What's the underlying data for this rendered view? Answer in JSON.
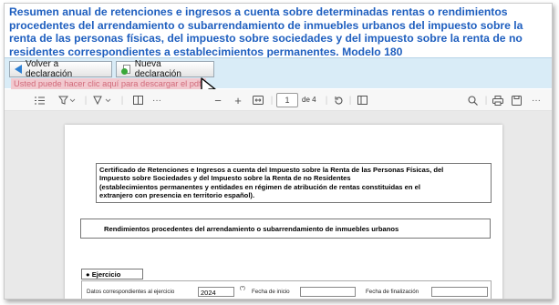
{
  "title": "Resumen anual de retenciones e ingresos a cuenta sobre determinadas rentas o rendimientos procedentes del arrendamiento o subarrendamiento de inmuebles urbanos del impuesto sobre la renta de las personas físicas, del impuesto sobre sociedades y del impuesto sobre la renta de no residentes correspondientes a establecimientos permanentes. Modelo 180",
  "buttons": {
    "back_label": "Volver a declaración",
    "new_label": "Nueva declaración"
  },
  "download_link": "Usted puede hacer clic aquí para descargar el pdf.",
  "pdf_toolbar": {
    "current_page": "1",
    "page_total": "de 4",
    "zoom_out": "−",
    "zoom_in": "+",
    "more": "···"
  },
  "document": {
    "certificate_lines": [
      "Certificado de Retenciones e Ingresos a cuenta del Impuesto sobre la Renta de las Personas Físicas, del",
      "Impuesto sobre Sociedades y del Impuesto sobre la Renta de no Residentes",
      "(establecimientos  permanentes y entidades en  régimen de atribución de  rentas constituidas en el",
      "extranjero con presencia en territorio español)."
    ],
    "section_heading": "Rendimientos procedentes del arrendamiento o subarrendamiento de inmuebles urbanos",
    "ejercicio_label": "● Ejercicio",
    "datos_label": "Datos correspondientes al ejercicio",
    "year_value": "2024",
    "note_mark": "(*)",
    "start_date_label": "Fecha de inicio",
    "end_date_label": "Fecha de finalización"
  },
  "colors": {
    "title": "#1f5fbf",
    "button_bar": "#d9ecf7",
    "link_bg": "#f2c9cf",
    "link_text": "#d16a7a"
  }
}
